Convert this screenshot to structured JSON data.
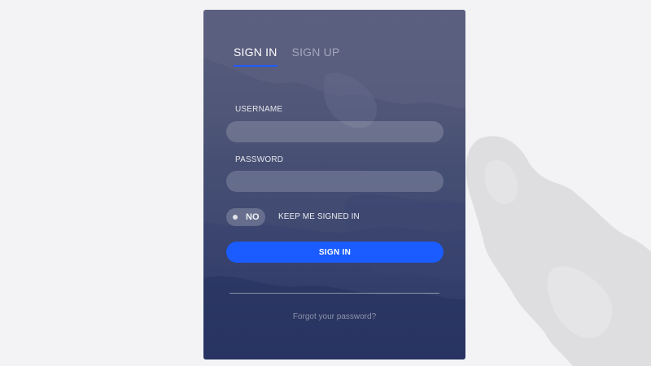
{
  "tabs": {
    "sign_in": "SIGN IN",
    "sign_up": "SIGN UP"
  },
  "form": {
    "username_label": "USERNAME",
    "username_value": "",
    "password_label": "PASSWORD",
    "password_value": "",
    "toggle_state": "NO",
    "keep_signed_in_label": "KEEP ME SIGNED IN",
    "submit_label": "SIGN IN",
    "forgot_link": "Forgot your password?"
  },
  "colors": {
    "accent": "#1a5cff",
    "page_background": "#f3f3f5",
    "card_top": "#585d7c",
    "card_bottom": "#2b3664"
  }
}
